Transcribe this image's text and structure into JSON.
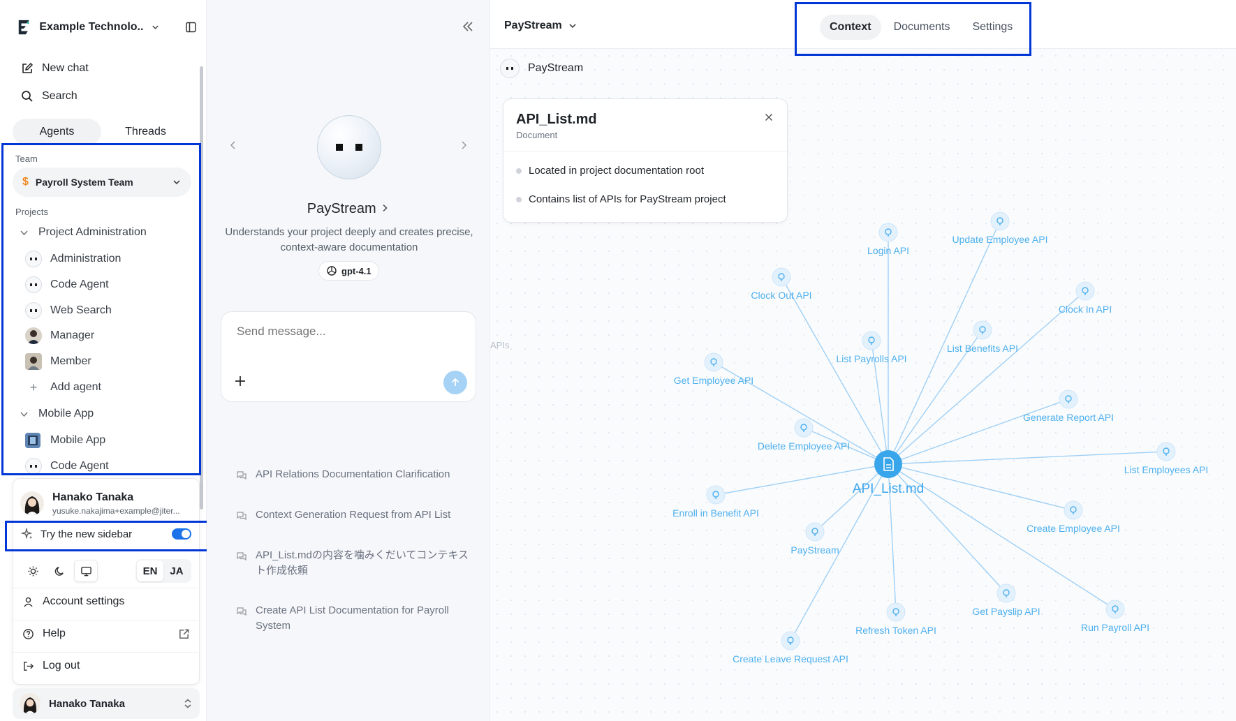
{
  "sidebar": {
    "org_name": "Example Technolo...",
    "new_chat": "New chat",
    "search": "Search",
    "tabs": [
      "Agents",
      "Threads"
    ],
    "team_label": "Team",
    "team_value": "Payroll System Team",
    "team_icon": "$",
    "projects_label": "Projects",
    "project_groups": [
      {
        "name": "Project Administration",
        "items": [
          {
            "label": "Administration",
            "icon": "agent-icon"
          },
          {
            "label": "Code Agent",
            "icon": "agent-icon"
          },
          {
            "label": "Web Search",
            "icon": "agent-icon"
          },
          {
            "label": "Manager",
            "icon": "person-avatar"
          },
          {
            "label": "Member",
            "icon": "person-avatar"
          },
          {
            "label": "Add agent",
            "icon": "plus-icon"
          }
        ]
      },
      {
        "name": "Mobile App",
        "items": [
          {
            "label": "Mobile App",
            "icon": "app-avatar"
          },
          {
            "label": "Code Agent",
            "icon": "agent-icon"
          }
        ]
      }
    ]
  },
  "user_menu": {
    "name": "Hanako Tanaka",
    "email": "yusuke.nakajima+example@jiter...",
    "new_sidebar_label": "Try the new sidebar",
    "new_sidebar_on": true,
    "lang_en": "EN",
    "lang_ja": "JA",
    "account_settings": "Account settings",
    "help": "Help",
    "logout": "Log out"
  },
  "bottom_user": {
    "name": "Hanako Tanaka"
  },
  "middle": {
    "agent_name": "PayStream",
    "agent_desc": "Understands your project deeply and creates precise, context-aware documentation",
    "model": "gpt-4.1",
    "composer_placeholder": "Send message...",
    "threads": [
      "API Relations Documentation Clarification",
      "Context Generation Request from API List",
      "API_List.mdの内容を噛みくだいてコンテキスト作成依頼",
      "Create API List Documentation for Payroll System"
    ]
  },
  "right": {
    "project": "PayStream",
    "tabs": [
      "Context",
      "Documents",
      "Settings"
    ],
    "active_tab": "Context",
    "graph_agent": "PayStream",
    "side_label": "APIs",
    "doc_card": {
      "title": "API_List.md",
      "type": "Document",
      "bullets": [
        "Located in project documentation root",
        "Contains list of APIs for PayStream project"
      ]
    },
    "graph": {
      "center_label": "API_List.md",
      "nodes": [
        "Login API",
        "Update Employee API",
        "Clock Out API",
        "Clock In API",
        "List Payrolls API",
        "List Benefits API",
        "Get Employee API",
        "Generate Report API",
        "Delete Employee API",
        "List Employees API",
        "Enroll in Benefit API",
        "Create Employee API",
        "PayStream",
        "Get Payslip API",
        "Refresh Token API",
        "Run Payroll API",
        "Create Leave Request API"
      ]
    }
  },
  "colors": {
    "accent": "#1a73e8",
    "graph_edge": "#9fd0f5",
    "graph_node": "#4db0ee",
    "highlight": "#0035d6"
  }
}
